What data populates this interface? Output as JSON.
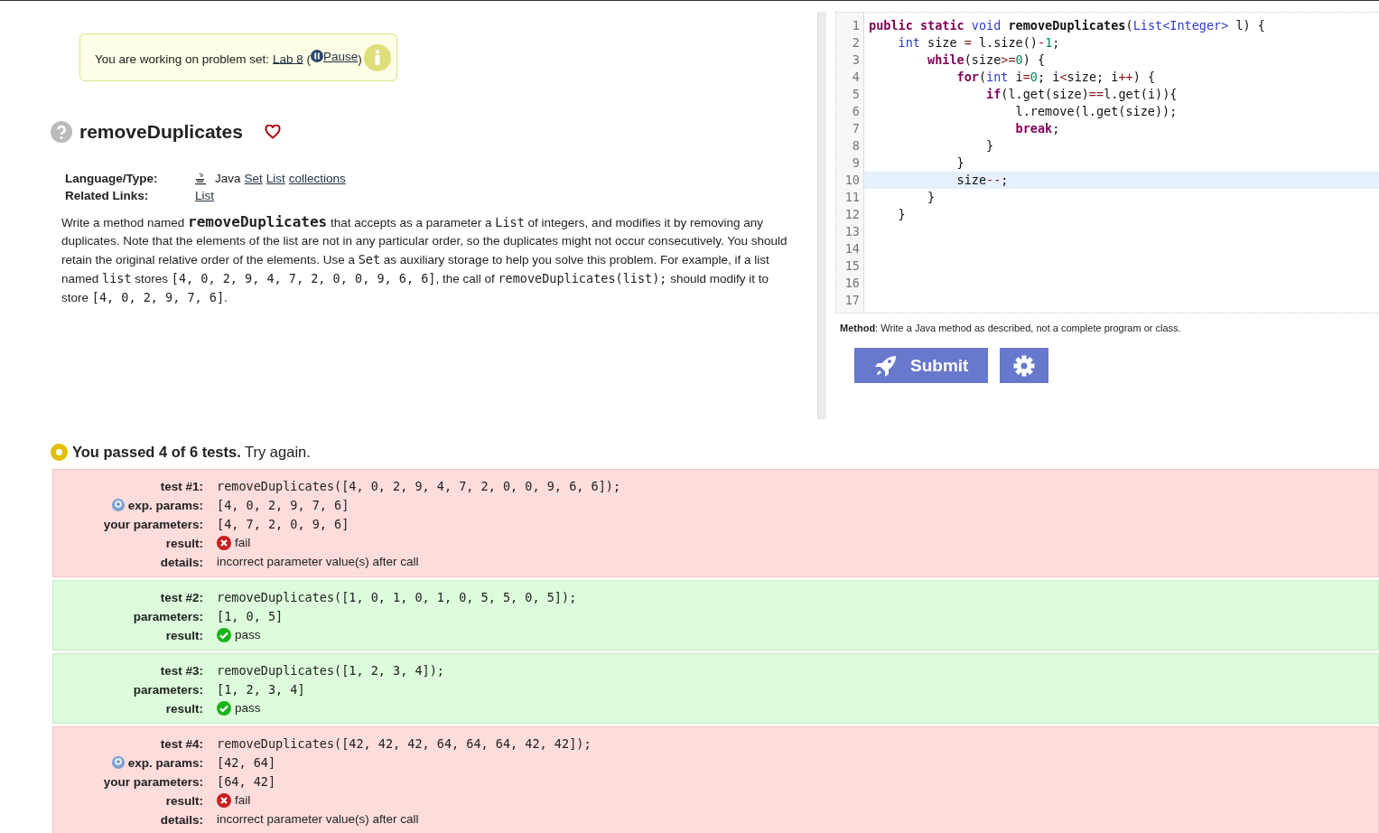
{
  "banner": {
    "text": "You are working on problem set: ",
    "set_link": "Lab 8",
    "paren_open": "(",
    "pause_link": " Pause",
    "paren_close": ")"
  },
  "problem": {
    "title": "removeDuplicates",
    "meta": [
      {
        "label": "Language/Type:",
        "language": "Java",
        "links": [
          "Set",
          "List",
          "collections"
        ]
      },
      {
        "label": "Related Links:",
        "links": [
          "List"
        ]
      }
    ],
    "description": [
      {
        "kind": "text",
        "text": "Write a method named "
      },
      {
        "kind": "name",
        "text": "removeDuplicates"
      },
      {
        "kind": "text",
        "text": " that accepts as a parameter a "
      },
      {
        "kind": "code",
        "text": "List"
      },
      {
        "kind": "text",
        "text": " of integers, and modifies it by removing any duplicates. Note that the elements of the list are not in any particular order, so the duplicates might not occur consecutively. You should retain the original relative order of the elements. Use a "
      },
      {
        "kind": "code",
        "text": "Set"
      },
      {
        "kind": "text",
        "text": " as auxiliary storage to help you solve this problem. For example, if a list named "
      },
      {
        "kind": "code",
        "text": "list"
      },
      {
        "kind": "text",
        "text": " stores "
      },
      {
        "kind": "code",
        "text": "[4, 0, 2, 9, 4, 7, 2, 0, 0, 9, 6, 6]"
      },
      {
        "kind": "text",
        "text": ", the call of "
      },
      {
        "kind": "code",
        "text": "removeDuplicates(list);"
      },
      {
        "kind": "text",
        "text": " should modify it to store "
      },
      {
        "kind": "code",
        "text": "[4, 0, 2, 9, 7, 6]"
      },
      {
        "kind": "text",
        "text": "."
      }
    ]
  },
  "editor": {
    "lines": [
      {
        "number": "1",
        "current": false,
        "tokens": [
          {
            "kind": "keyword",
            "text": "public static "
          },
          {
            "kind": "type",
            "text": "void "
          },
          {
            "kind": "name",
            "text": "removeDuplicates"
          },
          {
            "kind": "plain",
            "text": "("
          },
          {
            "kind": "type",
            "text": "List<Integer>"
          },
          {
            "kind": "plain",
            "text": " l) {"
          }
        ]
      },
      {
        "number": "2",
        "current": false,
        "tokens": [
          {
            "kind": "type",
            "text": "    int"
          },
          {
            "kind": "plain",
            "text": " size "
          },
          {
            "kind": "operator",
            "text": "="
          },
          {
            "kind": "plain",
            "text": " l.size()"
          },
          {
            "kind": "operator",
            "text": "-"
          },
          {
            "kind": "number",
            "text": "1"
          },
          {
            "kind": "plain",
            "text": ";"
          }
        ]
      },
      {
        "number": "3",
        "current": false,
        "tokens": [
          {
            "kind": "keyword",
            "text": "        while"
          },
          {
            "kind": "plain",
            "text": "(size"
          },
          {
            "kind": "operator",
            "text": ">="
          },
          {
            "kind": "number",
            "text": "0"
          },
          {
            "kind": "plain",
            "text": ") {"
          }
        ]
      },
      {
        "number": "4",
        "current": false,
        "tokens": [
          {
            "kind": "keyword",
            "text": "            for"
          },
          {
            "kind": "plain",
            "text": "("
          },
          {
            "kind": "type",
            "text": "int"
          },
          {
            "kind": "plain",
            "text": " i"
          },
          {
            "kind": "operator",
            "text": "="
          },
          {
            "kind": "number",
            "text": "0"
          },
          {
            "kind": "plain",
            "text": "; i"
          },
          {
            "kind": "operator",
            "text": "<"
          },
          {
            "kind": "plain",
            "text": "size; i"
          },
          {
            "kind": "operator",
            "text": "++"
          },
          {
            "kind": "plain",
            "text": ") {"
          }
        ]
      },
      {
        "number": "5",
        "current": false,
        "tokens": [
          {
            "kind": "keyword",
            "text": "                if"
          },
          {
            "kind": "plain",
            "text": "(l.get(size)"
          },
          {
            "kind": "operator",
            "text": "=="
          },
          {
            "kind": "plain",
            "text": "l.get(i)){"
          }
        ]
      },
      {
        "number": "6",
        "current": false,
        "tokens": [
          {
            "kind": "plain",
            "text": "                    l.remove(l.get(size));"
          }
        ]
      },
      {
        "number": "7",
        "current": false,
        "tokens": [
          {
            "kind": "keyword",
            "text": "                    break"
          },
          {
            "kind": "plain",
            "text": ";"
          }
        ]
      },
      {
        "number": "8",
        "current": false,
        "tokens": [
          {
            "kind": "plain",
            "text": "                }"
          }
        ]
      },
      {
        "number": "9",
        "current": false,
        "tokens": [
          {
            "kind": "plain",
            "text": "            }"
          }
        ]
      },
      {
        "number": "10",
        "current": true,
        "tokens": [
          {
            "kind": "plain",
            "text": "            size"
          },
          {
            "kind": "operator",
            "text": "--"
          },
          {
            "kind": "plain",
            "text": ";"
          }
        ]
      },
      {
        "number": "11",
        "current": false,
        "tokens": [
          {
            "kind": "plain",
            "text": "        }"
          }
        ]
      },
      {
        "number": "12",
        "current": false,
        "tokens": [
          {
            "kind": "plain",
            "text": "    }"
          }
        ]
      },
      {
        "number": "13",
        "current": false
      },
      {
        "number": "14",
        "current": false
      },
      {
        "number": "15",
        "current": false
      },
      {
        "number": "16",
        "current": false
      },
      {
        "number": "17",
        "current": false
      }
    ],
    "hint_label": "Method",
    "hint_text": ": Write a Java method as described, not a complete program or class.",
    "submit_label": "Submit"
  },
  "results": {
    "summary_bold": "You passed 4 of 6 tests.",
    "summary_rest": " Try again.",
    "tests": [
      {
        "passed": false,
        "rows": [
          {
            "kind": "code",
            "label": "test #1:",
            "value": "removeDuplicates([4, 0, 2, 9, 4, 7, 2, 0, 0, 9, 6, 6]);"
          },
          {
            "kind": "code",
            "label": "exp. params:",
            "help": true,
            "value": "[4, 0, 2, 9, 7, 6]"
          },
          {
            "kind": "code",
            "label": "your parameters:",
            "value": "[4, 7, 2, 0, 9, 6]"
          },
          {
            "kind": "result",
            "label": "result:",
            "value": "fail"
          },
          {
            "kind": "text",
            "label": "details:",
            "value": "incorrect parameter value(s) after call"
          }
        ]
      },
      {
        "passed": true,
        "rows": [
          {
            "kind": "code",
            "label": "test #2:",
            "value": "removeDuplicates([1, 0, 1, 0, 1, 0, 5, 5, 0, 5]);"
          },
          {
            "kind": "code",
            "label": "parameters:",
            "value": "[1, 0, 5]"
          },
          {
            "kind": "result",
            "label": "result:",
            "value": "pass"
          }
        ]
      },
      {
        "passed": true,
        "rows": [
          {
            "kind": "code",
            "label": "test #3:",
            "value": "removeDuplicates([1, 2, 3, 4]);"
          },
          {
            "kind": "code",
            "label": "parameters:",
            "value": "[1, 2, 3, 4]"
          },
          {
            "kind": "result",
            "label": "result:",
            "value": "pass"
          }
        ]
      },
      {
        "passed": false,
        "rows": [
          {
            "kind": "code",
            "label": "test #4:",
            "value": "removeDuplicates([42, 42, 42, 64, 64, 64, 42, 42]);"
          },
          {
            "kind": "code",
            "label": "exp. params:",
            "help": true,
            "value": "[42, 64]"
          },
          {
            "kind": "code",
            "label": "your parameters:",
            "value": "[64, 42]"
          },
          {
            "kind": "result",
            "label": "result:",
            "value": "fail"
          },
          {
            "kind": "text",
            "label": "details:",
            "value": "incorrect parameter value(s) after call"
          }
        ]
      }
    ]
  }
}
